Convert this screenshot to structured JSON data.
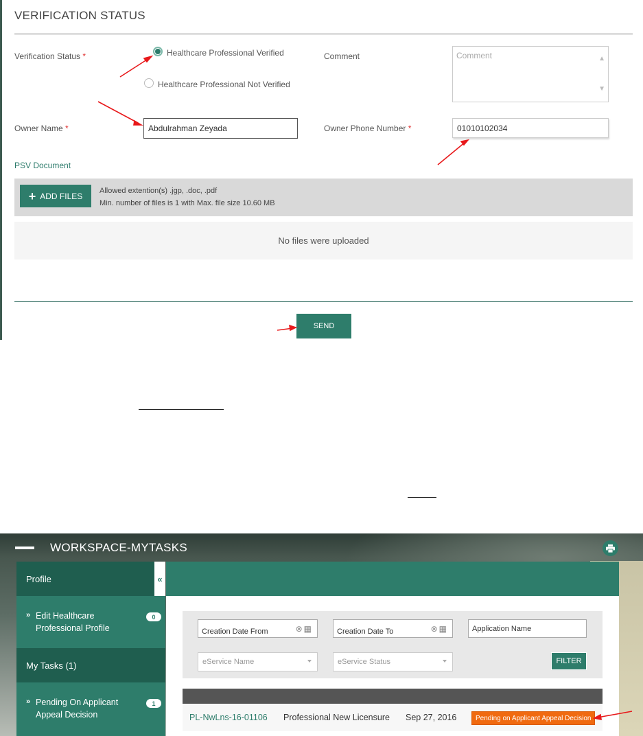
{
  "verification": {
    "title": "VERIFICATION STATUS",
    "status_label": "Verification Status",
    "required_mark": "*",
    "options": [
      {
        "label": "Healthcare Professional Verified",
        "checked": true
      },
      {
        "label": "Healthcare Professional Not Verified",
        "checked": false
      }
    ],
    "comment_label": "Comment",
    "comment_placeholder": "Comment",
    "owner_name_label": "Owner Name",
    "owner_name_value": "Abdulrahman Zeyada",
    "owner_phone_label": "Owner Phone Number",
    "owner_phone_value": "01010102034",
    "psv_label": "PSV Document",
    "add_files_label": "ADD FILES",
    "allowed_ext": "Allowed extention(s) .jgp, .doc, .pdf",
    "file_limits": "Min. number of files is 1 with Max. file size 10.60 MB",
    "no_files": "No files were uploaded",
    "send_label": "SEND"
  },
  "workspace": {
    "title": "WORKSPACE-MYTASKS",
    "sidebar": {
      "profile_label": "Profile",
      "edit_profile_label_1": "Edit Healthcare",
      "edit_profile_label_2": "Professional Profile",
      "edit_profile_count": "0",
      "my_tasks_label": "My Tasks (1)",
      "pending_label_1": "Pending On Applicant",
      "pending_label_2": "Appeal Decision",
      "pending_count": "1"
    },
    "filters": {
      "date_from": "Creation Date From",
      "date_to": "Creation Date To",
      "app_name": "Application Name",
      "eservice_name": "eService Name",
      "eservice_status": "eService Status",
      "filter_button": "FILTER"
    },
    "row": {
      "id": "PL-NwLns-16-01106",
      "service": "Professional New Licensure",
      "date": "Sep 27, 2016",
      "status": "Pending on Applicant Appeal Decision"
    }
  },
  "colors": {
    "accent": "#2e7d6b",
    "status_orange": "#f06a10",
    "arrow_red": "#e8191b"
  }
}
